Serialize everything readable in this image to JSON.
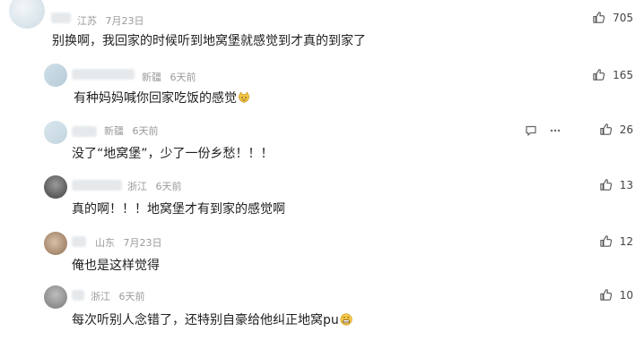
{
  "comments": [
    {
      "location": "江苏",
      "date": "7月23日",
      "text": "别换啊，我回家的时候听到地窝堡就感觉到才真的到家了",
      "likes": "705"
    },
    {
      "location": "新疆",
      "date": "6天前",
      "text": "有种妈妈喊你回家吃饭的感觉",
      "emoji": "cat-face-emoji",
      "likes": "165"
    },
    {
      "location": "新疆",
      "date": "6天前",
      "text": "没了“地窝堡”，少了一份乡愁！！！",
      "likes": "26"
    },
    {
      "location": "浙江",
      "date": "6天前",
      "text": "真的啊！！！地窝堡才有到家的感觉啊",
      "likes": "13"
    },
    {
      "location": "山东",
      "date": "7月23日",
      "text": "俺也是这样觉得",
      "likes": "12"
    },
    {
      "location": "浙江",
      "date": "6天前",
      "text": "每次听别人念错了，还特别自豪给他纠正地窝pu",
      "emoji": "grin-emoji",
      "likes": "10"
    }
  ],
  "icons": {
    "like": "thumbs-up-icon",
    "reply": "reply-icon",
    "more": "more-icon"
  }
}
